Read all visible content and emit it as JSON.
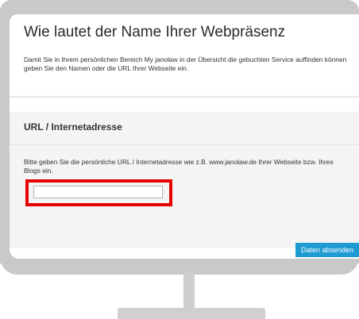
{
  "page": {
    "title": "Wie lautet der Name Ihrer Webpräsenz",
    "description": "Damit Sie in Ihrem persönlichen Bereich My janolaw in der Übersicht die gebuchten Service auffinden können geben Sie den Namen oder die URL Ihrer Webseite ein."
  },
  "url_section": {
    "heading": "URL / Internetadresse",
    "hint": "Bitte geben Sie die persönliche URL / Internetadresse wie z.B. www.janolaw.de Ihrer Webseite bzw. Ihres Blogs ein.",
    "input_value": "",
    "input_placeholder": ""
  },
  "actions": {
    "submit_label": "Daten absenden"
  },
  "colors": {
    "highlight": "#e60000",
    "button": "#1f9bd3",
    "frame": "#c9c9c9"
  }
}
